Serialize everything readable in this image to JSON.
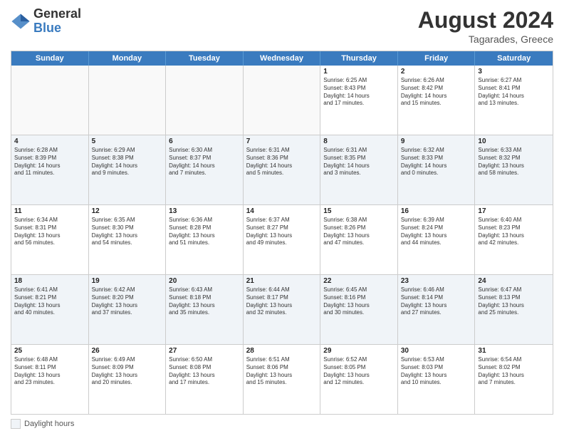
{
  "logo": {
    "general": "General",
    "blue": "Blue"
  },
  "title": {
    "month_year": "August 2024",
    "location": "Tagarades, Greece"
  },
  "days_header": [
    "Sunday",
    "Monday",
    "Tuesday",
    "Wednesday",
    "Thursday",
    "Friday",
    "Saturday"
  ],
  "weeks": [
    {
      "shaded": false,
      "cells": [
        {
          "day": "",
          "info": "",
          "empty": true
        },
        {
          "day": "",
          "info": "",
          "empty": true
        },
        {
          "day": "",
          "info": "",
          "empty": true
        },
        {
          "day": "",
          "info": "",
          "empty": true
        },
        {
          "day": "1",
          "info": "Sunrise: 6:25 AM\nSunset: 8:43 PM\nDaylight: 14 hours\nand 17 minutes.",
          "empty": false
        },
        {
          "day": "2",
          "info": "Sunrise: 6:26 AM\nSunset: 8:42 PM\nDaylight: 14 hours\nand 15 minutes.",
          "empty": false
        },
        {
          "day": "3",
          "info": "Sunrise: 6:27 AM\nSunset: 8:41 PM\nDaylight: 14 hours\nand 13 minutes.",
          "empty": false
        }
      ]
    },
    {
      "shaded": true,
      "cells": [
        {
          "day": "4",
          "info": "Sunrise: 6:28 AM\nSunset: 8:39 PM\nDaylight: 14 hours\nand 11 minutes.",
          "empty": false
        },
        {
          "day": "5",
          "info": "Sunrise: 6:29 AM\nSunset: 8:38 PM\nDaylight: 14 hours\nand 9 minutes.",
          "empty": false
        },
        {
          "day": "6",
          "info": "Sunrise: 6:30 AM\nSunset: 8:37 PM\nDaylight: 14 hours\nand 7 minutes.",
          "empty": false
        },
        {
          "day": "7",
          "info": "Sunrise: 6:31 AM\nSunset: 8:36 PM\nDaylight: 14 hours\nand 5 minutes.",
          "empty": false
        },
        {
          "day": "8",
          "info": "Sunrise: 6:31 AM\nSunset: 8:35 PM\nDaylight: 14 hours\nand 3 minutes.",
          "empty": false
        },
        {
          "day": "9",
          "info": "Sunrise: 6:32 AM\nSunset: 8:33 PM\nDaylight: 14 hours\nand 0 minutes.",
          "empty": false
        },
        {
          "day": "10",
          "info": "Sunrise: 6:33 AM\nSunset: 8:32 PM\nDaylight: 13 hours\nand 58 minutes.",
          "empty": false
        }
      ]
    },
    {
      "shaded": false,
      "cells": [
        {
          "day": "11",
          "info": "Sunrise: 6:34 AM\nSunset: 8:31 PM\nDaylight: 13 hours\nand 56 minutes.",
          "empty": false
        },
        {
          "day": "12",
          "info": "Sunrise: 6:35 AM\nSunset: 8:30 PM\nDaylight: 13 hours\nand 54 minutes.",
          "empty": false
        },
        {
          "day": "13",
          "info": "Sunrise: 6:36 AM\nSunset: 8:28 PM\nDaylight: 13 hours\nand 51 minutes.",
          "empty": false
        },
        {
          "day": "14",
          "info": "Sunrise: 6:37 AM\nSunset: 8:27 PM\nDaylight: 13 hours\nand 49 minutes.",
          "empty": false
        },
        {
          "day": "15",
          "info": "Sunrise: 6:38 AM\nSunset: 8:26 PM\nDaylight: 13 hours\nand 47 minutes.",
          "empty": false
        },
        {
          "day": "16",
          "info": "Sunrise: 6:39 AM\nSunset: 8:24 PM\nDaylight: 13 hours\nand 44 minutes.",
          "empty": false
        },
        {
          "day": "17",
          "info": "Sunrise: 6:40 AM\nSunset: 8:23 PM\nDaylight: 13 hours\nand 42 minutes.",
          "empty": false
        }
      ]
    },
    {
      "shaded": true,
      "cells": [
        {
          "day": "18",
          "info": "Sunrise: 6:41 AM\nSunset: 8:21 PM\nDaylight: 13 hours\nand 40 minutes.",
          "empty": false
        },
        {
          "day": "19",
          "info": "Sunrise: 6:42 AM\nSunset: 8:20 PM\nDaylight: 13 hours\nand 37 minutes.",
          "empty": false
        },
        {
          "day": "20",
          "info": "Sunrise: 6:43 AM\nSunset: 8:18 PM\nDaylight: 13 hours\nand 35 minutes.",
          "empty": false
        },
        {
          "day": "21",
          "info": "Sunrise: 6:44 AM\nSunset: 8:17 PM\nDaylight: 13 hours\nand 32 minutes.",
          "empty": false
        },
        {
          "day": "22",
          "info": "Sunrise: 6:45 AM\nSunset: 8:16 PM\nDaylight: 13 hours\nand 30 minutes.",
          "empty": false
        },
        {
          "day": "23",
          "info": "Sunrise: 6:46 AM\nSunset: 8:14 PM\nDaylight: 13 hours\nand 27 minutes.",
          "empty": false
        },
        {
          "day": "24",
          "info": "Sunrise: 6:47 AM\nSunset: 8:13 PM\nDaylight: 13 hours\nand 25 minutes.",
          "empty": false
        }
      ]
    },
    {
      "shaded": false,
      "cells": [
        {
          "day": "25",
          "info": "Sunrise: 6:48 AM\nSunset: 8:11 PM\nDaylight: 13 hours\nand 23 minutes.",
          "empty": false
        },
        {
          "day": "26",
          "info": "Sunrise: 6:49 AM\nSunset: 8:09 PM\nDaylight: 13 hours\nand 20 minutes.",
          "empty": false
        },
        {
          "day": "27",
          "info": "Sunrise: 6:50 AM\nSunset: 8:08 PM\nDaylight: 13 hours\nand 17 minutes.",
          "empty": false
        },
        {
          "day": "28",
          "info": "Sunrise: 6:51 AM\nSunset: 8:06 PM\nDaylight: 13 hours\nand 15 minutes.",
          "empty": false
        },
        {
          "day": "29",
          "info": "Sunrise: 6:52 AM\nSunset: 8:05 PM\nDaylight: 13 hours\nand 12 minutes.",
          "empty": false
        },
        {
          "day": "30",
          "info": "Sunrise: 6:53 AM\nSunset: 8:03 PM\nDaylight: 13 hours\nand 10 minutes.",
          "empty": false
        },
        {
          "day": "31",
          "info": "Sunrise: 6:54 AM\nSunset: 8:02 PM\nDaylight: 13 hours\nand 7 minutes.",
          "empty": false
        }
      ]
    }
  ],
  "legend": {
    "label": "Daylight hours"
  }
}
